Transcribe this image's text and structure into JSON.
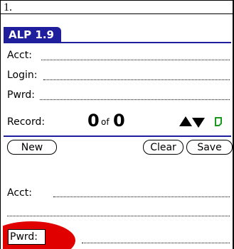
{
  "doc": {
    "step": "1."
  },
  "app": {
    "title": "ALP 1.9",
    "title_color": "#1f1f9e"
  },
  "upper_form": {
    "fields": [
      {
        "label": "Acct:",
        "value": ""
      },
      {
        "label": "Login:",
        "value": ""
      },
      {
        "label": "Pwrd:",
        "value": ""
      }
    ]
  },
  "record_nav": {
    "label": "Record:",
    "current": "0",
    "of": "of",
    "total": "0",
    "up_icon": "triangle-up",
    "down_icon": "triangle-down",
    "note_icon": "note",
    "note_color": "#1a9a1a"
  },
  "buttons": {
    "new": "New",
    "clear": "Clear",
    "save": "Save"
  },
  "lower_form": {
    "acct_label": "Acct:",
    "pwrd_label": "Pwrd:",
    "highlight_color": "#e00000"
  }
}
